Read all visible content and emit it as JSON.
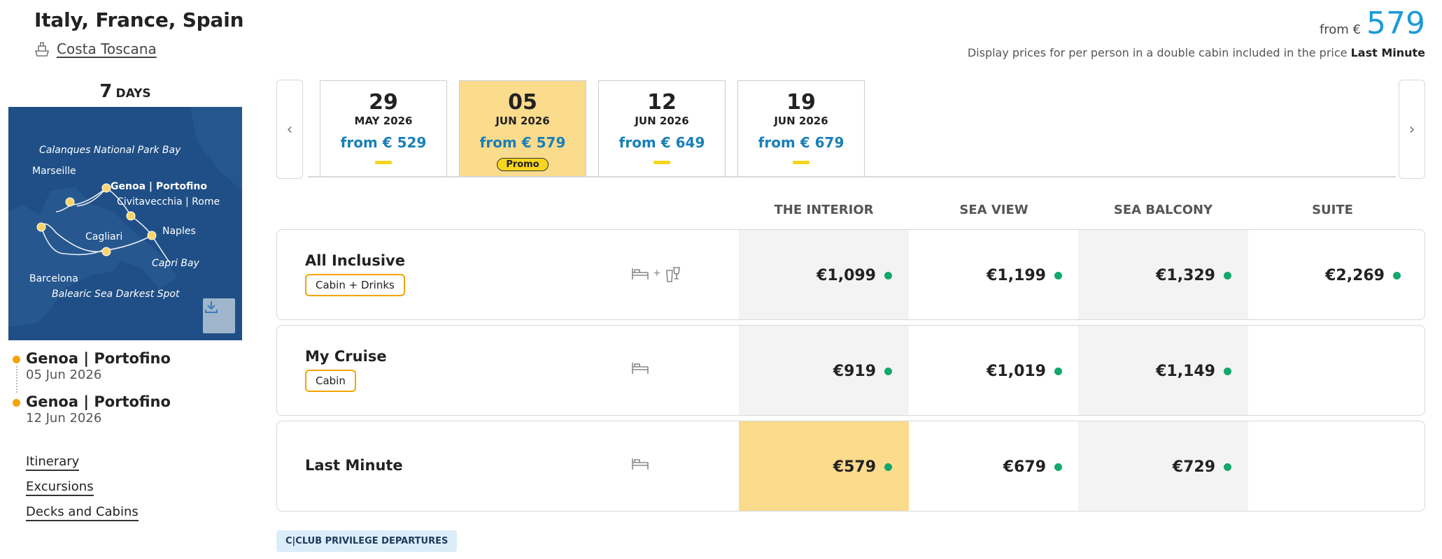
{
  "header": {
    "title": "Italy, France, Spain",
    "ship_name": "Costa Toscana",
    "from_label": "from €",
    "from_price": "579",
    "price_note": "Display prices for per person in a double cabin included in the price",
    "price_note_bold": "Last Minute"
  },
  "sidebar": {
    "days_number": "7",
    "days_label": "DAYS",
    "map_labels": [
      "Calanques National Park Bay",
      "Marseille",
      "Genoa | Portofino",
      "Civitavecchia | Rome",
      "Cagliari",
      "Naples",
      "Capri Bay",
      "Barcelona",
      "Balearic Sea Darkest Spot"
    ],
    "route": [
      {
        "port": "Genoa | Portofino",
        "date": "05 Jun 2026"
      },
      {
        "port": "Genoa | Portofino",
        "date": "12 Jun 2026"
      }
    ],
    "links": [
      "Itinerary",
      "Excursions",
      "Decks and Cabins"
    ]
  },
  "dates": [
    {
      "day": "29",
      "month": "MAY 2026",
      "price": "from € 529",
      "active": false
    },
    {
      "day": "05",
      "month": "JUN 2026",
      "price": "from € 579",
      "active": true,
      "badge": "Promo"
    },
    {
      "day": "12",
      "month": "JUN 2026",
      "price": "from € 649",
      "active": false
    },
    {
      "day": "19",
      "month": "JUN 2026",
      "price": "from € 679",
      "active": false
    }
  ],
  "table": {
    "columns": [
      "THE INTERIOR",
      "SEA VIEW",
      "SEA BALCONY",
      "SUITE"
    ],
    "rows": [
      {
        "name": "All Inclusive",
        "tag": "Cabin + Drinks",
        "icons_plus": "+",
        "prices": [
          "€1,099",
          "€1,199",
          "€1,329",
          "€2,269"
        ]
      },
      {
        "name": "My Cruise",
        "tag": "Cabin",
        "prices": [
          "€919",
          "€1,019",
          "€1,149",
          ""
        ]
      },
      {
        "name": "Last Minute",
        "tag": "",
        "prices": [
          "€579",
          "€679",
          "€729",
          ""
        ]
      }
    ]
  },
  "club_badge": "C|CLUB PRIVILEGE DEPARTURES",
  "colors": {
    "accent_blue": "#1a9bd8",
    "highlight_yellow": "#fbdb8c",
    "promo_yellow": "#f7d51d",
    "available_green": "#11a86b",
    "tag_orange": "#f5a300"
  }
}
